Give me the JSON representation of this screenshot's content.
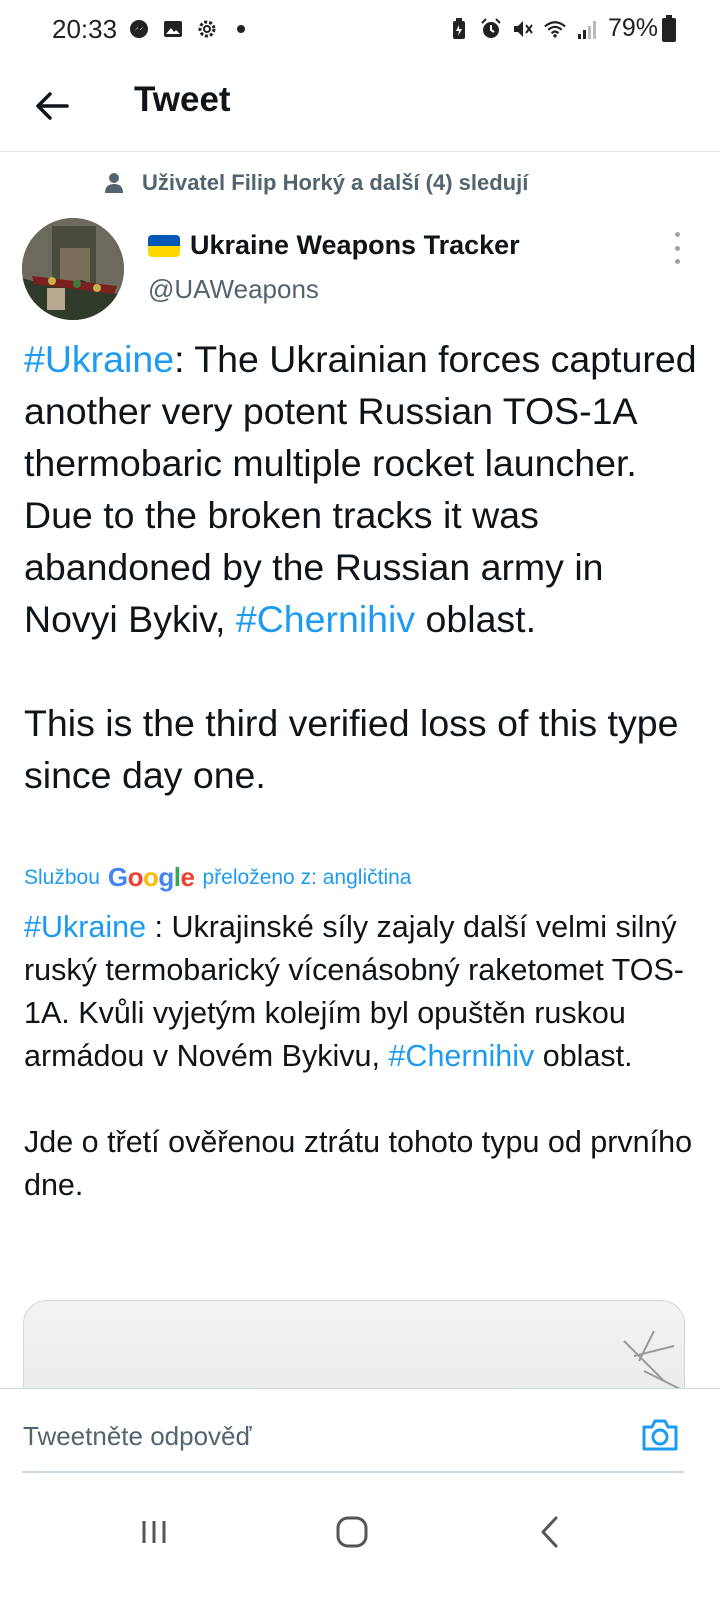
{
  "status_bar": {
    "time": "20:33",
    "battery": "79%",
    "left_icons": [
      "messenger-icon",
      "gallery-icon",
      "settings-icon",
      "dot-icon"
    ],
    "right_icons": [
      "battery-saver-icon",
      "alarm-icon",
      "mute-icon",
      "wifi-icon",
      "signal-icon"
    ]
  },
  "header": {
    "title": "Tweet"
  },
  "social_context": {
    "text": "Uživatel Filip Horký a další (4) sledují"
  },
  "author": {
    "name": "Ukraine Weapons Tracker",
    "handle": "@UAWeapons"
  },
  "tweet": {
    "hashtag_1": "#Ukraine",
    "text_1": ": The Ukrainian forces captured another very potent Russian TOS-1A thermobaric multiple rocket launcher. Due to the broken tracks it was abandoned by the Russian army in Novyi Bykiv,",
    "hashtag_2": "#Chernihiv",
    "text_2": " oblast.",
    "text_3": "This is the third verified loss of this type since day one."
  },
  "translation_meta": {
    "prefix": "Službou",
    "google_letters": [
      "G",
      "o",
      "o",
      "g",
      "l",
      "e"
    ],
    "suffix": "přeloženo z: angličtina"
  },
  "translation": {
    "hashtag_1": "#Ukraine",
    "text_1": " : Ukrajinské síly zajaly další velmi silný ruský termobarický vícenásobný raketomet TOS-1A. Kvůli vyjetým kolejím byl opuštěn ruskou armádou v Novém Bykivu,",
    "hashtag_2": "#Chernihiv",
    "text_2": " oblast.",
    "text_3": " Jde o třetí ověřenou ztrátu tohoto typu od prvního dne."
  },
  "reply": {
    "placeholder": "Tweetněte odpověď"
  },
  "colors": {
    "link": "#1d9bf0",
    "secondary_text": "#536471",
    "primary_text": "#0f1419"
  }
}
